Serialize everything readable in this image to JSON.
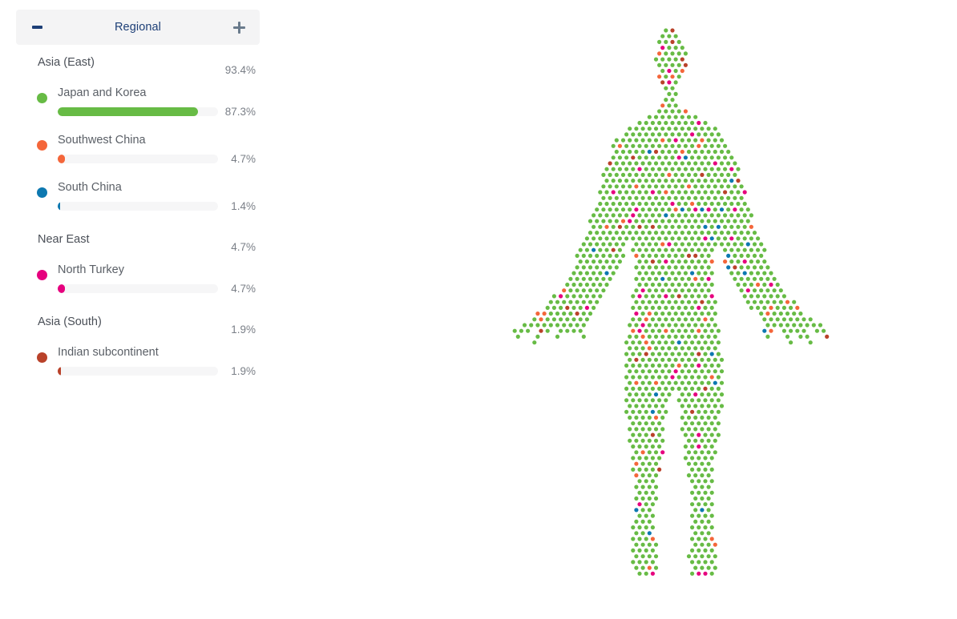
{
  "panel": {
    "title": "Regional",
    "collapse_icon": "minus-icon",
    "expand_icon": "plus-icon"
  },
  "groups": [
    {
      "name": "Asia (East)",
      "percent": "93.4%",
      "value": 93.4,
      "regions": [
        {
          "name": "Japan and Korea",
          "percent": "87.3%",
          "value": 87.3,
          "color": "#67bb45"
        },
        {
          "name": "Southwest China",
          "percent": "4.7%",
          "value": 4.7,
          "color": "#f4663a"
        },
        {
          "name": "South China",
          "percent": "1.4%",
          "value": 1.4,
          "color": "#0d78b0"
        }
      ]
    },
    {
      "name": "Near East",
      "percent": "4.7%",
      "value": 4.7,
      "regions": [
        {
          "name": "North Turkey",
          "percent": "4.7%",
          "value": 4.7,
          "color": "#e6007e"
        }
      ]
    },
    {
      "name": "Asia (South)",
      "percent": "1.9%",
      "value": 1.9,
      "regions": [
        {
          "name": "Indian subcontinent",
          "percent": "1.9%",
          "value": 1.9,
          "color": "#b9422a"
        }
      ]
    }
  ],
  "figure": {
    "name": "human-body-dot-silhouette",
    "dot_colors": {
      "Japan and Korea": "#67bb45",
      "Southwest China": "#f4663a",
      "South China": "#0d78b0",
      "North Turkey": "#e6007e",
      "Indian subcontinent": "#b9422a"
    },
    "dot_radius": 2.6,
    "dot_spacing": 8.2
  },
  "chart_data": {
    "type": "bar",
    "title": "Regional",
    "categories": [
      "Japan and Korea",
      "Southwest China",
      "South China",
      "North Turkey",
      "Indian subcontinent"
    ],
    "values": [
      87.3,
      4.7,
      1.4,
      4.7,
      1.9
    ],
    "group_categories": [
      "Asia (East)",
      "Near East",
      "Asia (South)"
    ],
    "group_values": [
      93.4,
      4.7,
      1.9
    ],
    "xlabel": "",
    "ylabel": "Percent",
    "ylim": [
      0,
      100
    ],
    "legend": [
      "Japan and Korea",
      "Southwest China",
      "South China",
      "North Turkey",
      "Indian subcontinent"
    ],
    "colors": [
      "#67bb45",
      "#f4663a",
      "#0d78b0",
      "#e6007e",
      "#b9422a"
    ],
    "grid": false,
    "legend_position": "left-sidebar"
  }
}
